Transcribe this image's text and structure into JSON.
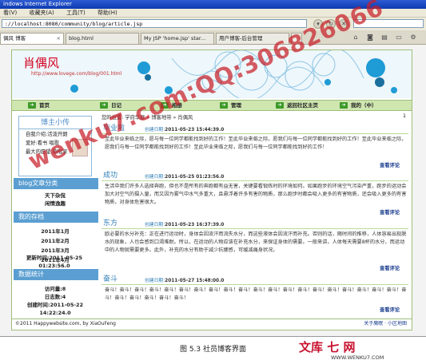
{
  "browser": {
    "title": "indows Internet Explorer",
    "menu": [
      "看(V)",
      "收藏夹(A)",
      "工具(T)",
      "帮助(H)"
    ],
    "address": "://localhost:8080/community/blog/article.jsp",
    "tabs": [
      "偶风 博客",
      "blog.html",
      "My JSP 'home.jsp' star...",
      "用户博客-后台管理"
    ]
  },
  "banner": {
    "title": "肖偶风",
    "url": "http://www.lovege.com/blog/001.html"
  },
  "nav": [
    "首页",
    "日记",
    "相册",
    "管理",
    "返回社区主页",
    "我的（中）"
  ],
  "sidebar": {
    "author_heading": "博主小传",
    "author_lines": [
      "自我介绍:活泼开朗",
      "爱好:看书 唱歌",
      "最大的愿望:歌唱家"
    ],
    "category_heading": "blog文章分类",
    "categories": [
      "天下杂侃",
      "闲情逸趣"
    ],
    "archive_heading": "我的存档",
    "archives": [
      "2011年1月",
      "2011年2月",
      "2011年3月",
      "2011年4月"
    ],
    "stats_heading": "数据统计",
    "stats": {
      "visits": "访问量:8",
      "posts": "日志数:4",
      "created_label": "创建时间:2011-05-22",
      "created_time": "14:22:24.0",
      "updated_label": "更新时间:2011-05-25",
      "updated_time": "01:23:56.0"
    }
  },
  "main": {
    "breadcrumb": "您的位置: 学府华庭 » 博客地带 » 肖偶风",
    "page": "1",
    "posts": [
      {
        "title": "毕业啦",
        "date_label": "创建日期:",
        "date": "2011-05-23 15:44:39.0",
        "body": "至此毕业来临之际，愿与每一位同学都能找到好的工作！至此毕业来临之际，愿我们与每一位同学都能找到好的工作！至此毕业来临之际，愿我们与每一位同学都能找到好的工作！至此毕业来临之际，愿我们与每一位同学都能找到好的工作！",
        "comment": "查看评论"
      },
      {
        "title": "成功",
        "date_label": "创建日期:",
        "date": "2011-05-25 01:23:56.0",
        "body": "生活中我们许多人选择奔跑，但也不是所有的奔跑都有益无害，关键要看锻炼时的环境如何。如果跑步的环境空气污染严重，跑步的运动会加大对空气的摄入量，而又因为雾气中水气多重大，且悬浮着许多有害的物质，那么跑步时都会吸入更多的有害物质，还会吸入更多的有害物质，对身体危害很大。",
        "comment": "查看评论"
      },
      {
        "title": "东方",
        "date_label": "创建日期:",
        "date": "2011-05-23 16:37:39.0",
        "body": "欧必要的水分补充：正在进行运动时，身体会因流汗而流失水分，而这些液体会因流汗而补充。否则的话，随时间的推移，人体容易出现脱水的现象，人也会感到口渴难耐。所以，在运动的人物应该在补充水分，来保证身体的需要。一般来讲，人体每天需要8杯的水分，而运动中的人物就需要更多。此外，补充的水分有助于减少抗痿感，可缓减痛身状况。",
        "comment": "查看评论"
      },
      {
        "title": "奋斗",
        "date_label": "创建日期:",
        "date": "2011-05-27 15:48:00.0",
        "body": "奋斗！奋斗！奋斗！奋斗！奋斗！奋斗！奋斗！奋斗！奋斗！奋斗！奋斗！奋斗！奋斗！奋斗！奋斗！奋斗！奋斗！奋斗！奋斗！奋斗！奋斗！奋斗！奋斗！奋斗！奋斗！奋斗！",
        "comment": "查看评论"
      }
    ]
  },
  "footer": {
    "copyright": "©2011 Happywebsite.com, by XiaOuFeng",
    "links": "关于魔眠 · 小区地图"
  },
  "caption": "图 5.3 社员博客界面",
  "watermark": "wenku7.com:QQ:306826066",
  "wm_logo": "文库 七 网",
  "wm_url": "WWW.WENKU7.COM"
}
